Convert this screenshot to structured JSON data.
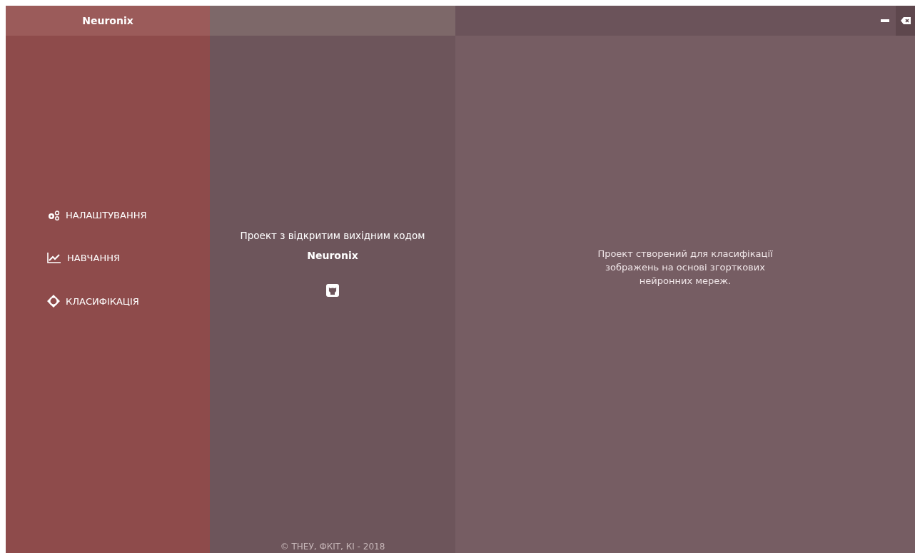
{
  "window": {
    "title": "Neuronix"
  },
  "sidebar": {
    "items": [
      {
        "label": "НАЛАШТУВАННЯ"
      },
      {
        "label": "НАВЧАННЯ"
      },
      {
        "label": "КЛАСИФІКАЦІЯ"
      }
    ]
  },
  "about": {
    "intro": "Проект з відкритим вихідним кодом",
    "name": "Neuronix",
    "footer": "© ТНЕУ, ФКІТ, КІ - 2018"
  },
  "description": "Проект створений для класифікації зображень на основі згорткових нейронних мереж."
}
